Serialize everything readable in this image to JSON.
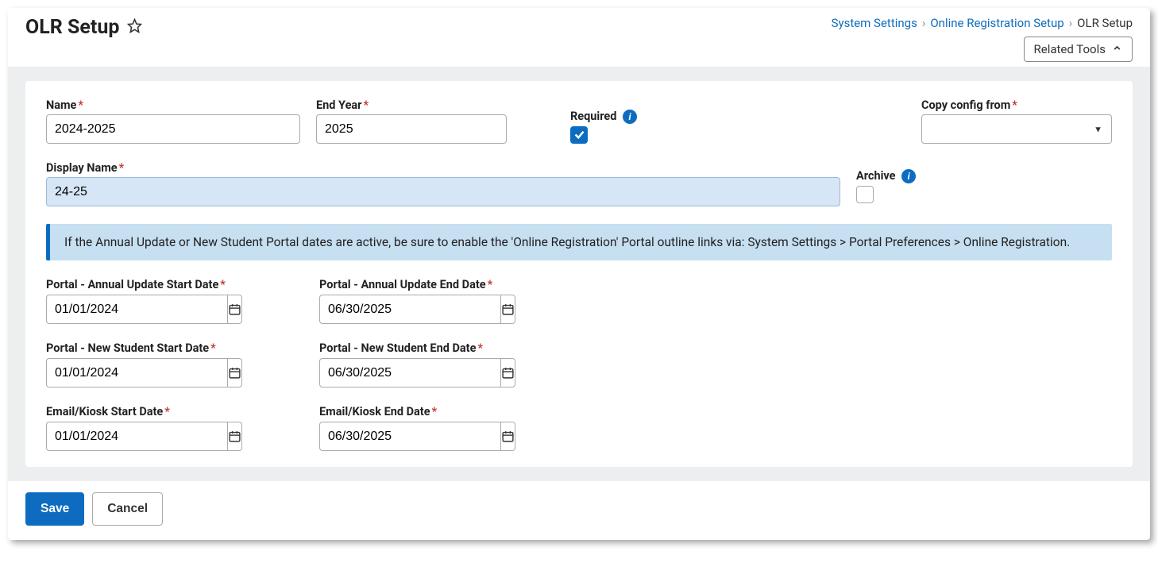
{
  "header": {
    "title": "OLR Setup",
    "breadcrumb": {
      "l1": "System Settings",
      "l2": "Online Registration Setup",
      "l3": "OLR Setup"
    },
    "related_tools": "Related Tools"
  },
  "form": {
    "name_label": "Name",
    "name_value": "2024-2025",
    "end_year_label": "End Year",
    "end_year_value": "2025",
    "required_label": "Required",
    "required_checked": true,
    "copy_config_label": "Copy config from",
    "copy_config_value": "",
    "display_name_label": "Display Name",
    "display_name_value": "24-25",
    "archive_label": "Archive",
    "archive_checked": false
  },
  "banner": "If the Annual Update or New Student Portal dates are active, be sure to enable the 'Online Registration' Portal outline links via: System Settings > Portal Preferences > Online Registration.",
  "dates": {
    "annual_start_label": "Portal - Annual Update Start Date",
    "annual_start_value": "01/01/2024",
    "annual_end_label": "Portal - Annual Update End Date",
    "annual_end_value": "06/30/2025",
    "newstudent_start_label": "Portal - New Student Start Date",
    "newstudent_start_value": "01/01/2024",
    "newstudent_end_label": "Portal - New Student End Date",
    "newstudent_end_value": "06/30/2025",
    "emailkiosk_start_label": "Email/Kiosk Start Date",
    "emailkiosk_start_value": "01/01/2024",
    "emailkiosk_end_label": "Email/Kiosk End Date",
    "emailkiosk_end_value": "06/30/2025"
  },
  "footer": {
    "save": "Save",
    "cancel": "Cancel"
  }
}
